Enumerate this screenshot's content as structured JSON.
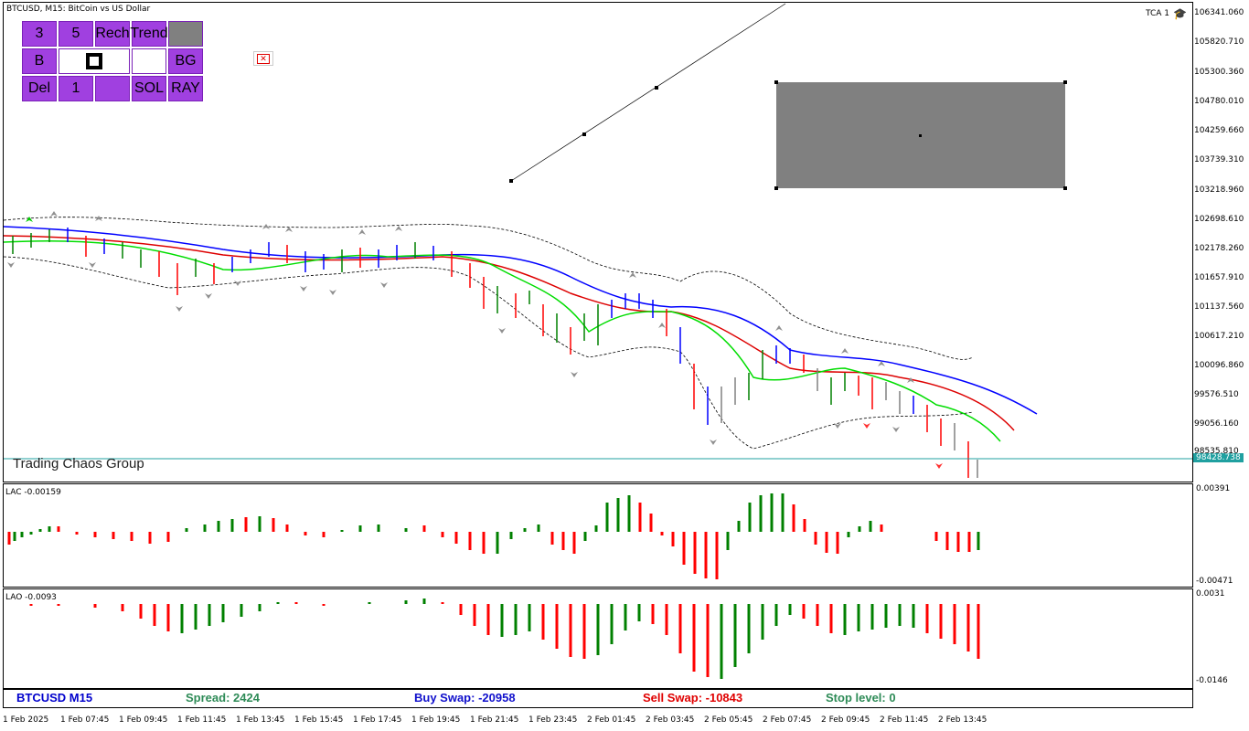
{
  "header": {
    "title": "BTCUSD, M15:  BitCoin vs US Dollar",
    "tca_label": "TCA 1"
  },
  "panel": {
    "row1": [
      "3",
      "5",
      "Rech",
      "Trend",
      ""
    ],
    "row2": [
      "B",
      "",
      "",
      "BG"
    ],
    "row3": [
      "Del",
      "1",
      "",
      "SOL",
      "RAY"
    ]
  },
  "watermark": "Trading Chaos Group",
  "price_axis": [
    "106341.060",
    "105820.710",
    "105300.360",
    "104780.010",
    "104259.660",
    "103739.310",
    "103218.960",
    "102698.610",
    "102178.260",
    "101657.910",
    "101137.560",
    "100617.210",
    "100096.860",
    "99576.510",
    "99056.160",
    "98535.810"
  ],
  "current_price": "98428.738",
  "lac": {
    "label": "LAC -0.00159",
    "top": "0.00391",
    "bottom": "-0.00471"
  },
  "lao": {
    "label": "LAO -0.0093",
    "top": "0.0031",
    "bottom": "-0.0146"
  },
  "status": {
    "symbol": "BTCUSD M15",
    "spread": "Spread: 2424",
    "buy_swap": "Buy Swap: -20958",
    "sell_swap": "Sell Swap: -10843",
    "stop_level": "Stop level: 0"
  },
  "time_axis": [
    "1 Feb 2025",
    "1 Feb 07:45",
    "1 Feb 09:45",
    "1 Feb 11:45",
    "1 Feb 13:45",
    "1 Feb 15:45",
    "1 Feb 17:45",
    "1 Feb 19:45",
    "1 Feb 21:45",
    "1 Feb 23:45",
    "2 Feb 01:45",
    "2 Feb 03:45",
    "2 Feb 05:45",
    "2 Feb 07:45",
    "2 Feb 09:45",
    "2 Feb 11:45",
    "2 Feb 13:45"
  ],
  "colors": {
    "accent_purple": "#a040e0",
    "bull": "#008000",
    "bear": "#ff0000",
    "ma_blue": "#0000ff",
    "ma_red": "#dd0000",
    "ma_green": "#00dd00",
    "status_symbol": "#0000cc",
    "status_spread": "#2e8b57",
    "status_buy": "#1010cc",
    "status_sell": "#e00000",
    "status_stop": "#2e8b57"
  }
}
